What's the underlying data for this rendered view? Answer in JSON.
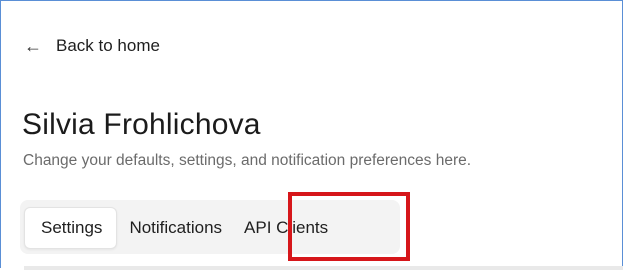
{
  "nav": {
    "back_icon": "arrow-left-icon",
    "back_label": "Back to home"
  },
  "header": {
    "title": "Silvia Frohlichova",
    "subtitle": "Change your defaults, settings, and notification preferences here."
  },
  "tabs": [
    {
      "label": "Settings",
      "selected": true
    },
    {
      "label": "Notifications",
      "selected": false
    },
    {
      "label": "API Clients",
      "selected": false,
      "highlighted": true
    }
  ],
  "colors": {
    "highlight": "#d6161a",
    "frame": "#5a8fd6"
  }
}
